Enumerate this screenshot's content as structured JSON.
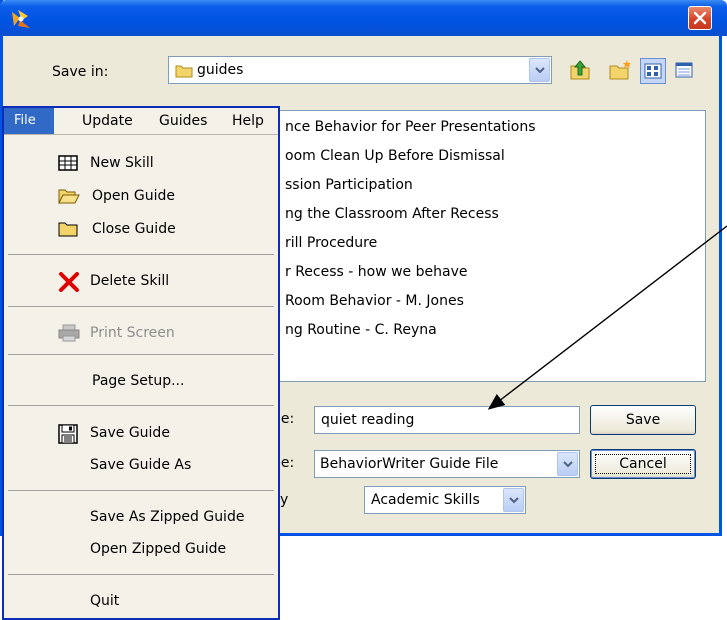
{
  "dialog": {
    "save_in_label": "Save in:",
    "save_in_value": "guides",
    "files": [
      "nce Behavior for Peer Presentations",
      "oom Clean Up Before Dismissal",
      "ssion Participation",
      "ng the Classroom After Recess",
      "rill Procedure",
      "r Recess - how we behave",
      " Room Behavior - M. Jones",
      "ng Routine - C. Reyna"
    ],
    "file_name_label": "ne:",
    "file_name_value": "quiet reading",
    "file_type_label": "pe:",
    "file_type_value": "BehaviorWriter Guide File",
    "category_label": "y",
    "category_value": "Academic Skills",
    "save_button": "Save",
    "cancel_button": "Cancel"
  },
  "menubar": {
    "items": [
      "File",
      "Update",
      "Guides",
      "Help"
    ]
  },
  "file_menu": {
    "items": [
      {
        "label": "New Skill",
        "icon": "table-icon"
      },
      {
        "label": "Open Guide",
        "icon": "open-folder-icon"
      },
      {
        "label": "Close Guide",
        "icon": "folder-icon"
      },
      {
        "label": "Delete Skill",
        "icon": "red-x-icon"
      },
      {
        "label": "Print Screen",
        "icon": "printer-icon",
        "disabled": true
      },
      {
        "label": "Page Setup...",
        "icon": ""
      },
      {
        "label": "Save Guide",
        "icon": "floppy-disk-icon"
      },
      {
        "label": "Save Guide As",
        "icon": ""
      },
      {
        "label": "Save As Zipped Guide",
        "icon": ""
      },
      {
        "label": "Open Zipped Guide",
        "icon": ""
      },
      {
        "label": "Quit",
        "icon": ""
      }
    ]
  },
  "colors": {
    "title_bar": "#0054e3",
    "menu_highlight": "#3169c6",
    "close_button": "#d5452a"
  }
}
